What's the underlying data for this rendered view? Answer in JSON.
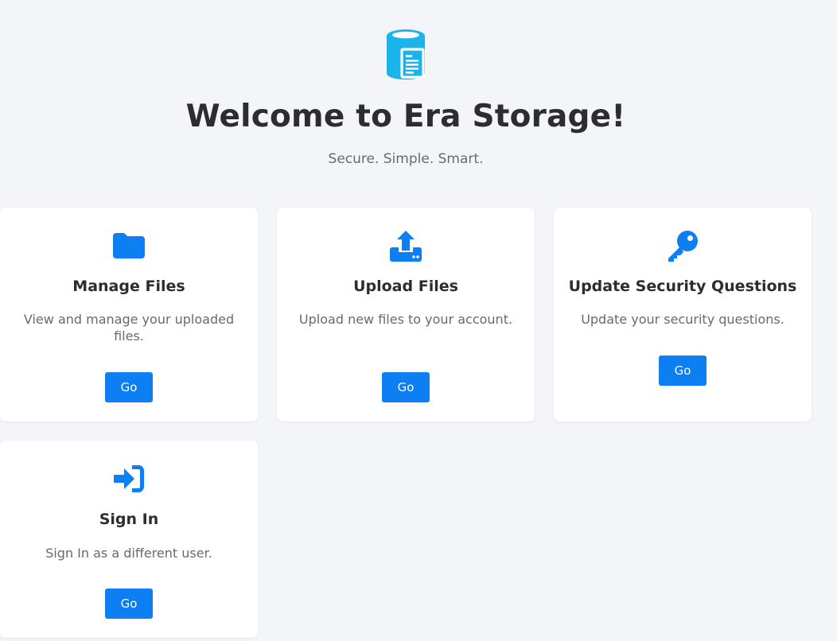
{
  "header": {
    "logo_icon": "database-document-icon",
    "title": "Welcome to Era Storage!",
    "tagline": "Secure. Simple. Smart."
  },
  "colors": {
    "background": "#f4f5f9",
    "accent": "#0d7ff2",
    "logo": "#1ab4ea",
    "heading": "#2d2d31",
    "muted": "#666a70"
  },
  "cards": [
    {
      "icon": "folder-icon",
      "title": "Manage Files",
      "description": "View and manage your uploaded files.",
      "button": "Go"
    },
    {
      "icon": "upload-icon",
      "title": "Upload Files",
      "description": "Upload new files to your account.",
      "button": "Go"
    },
    {
      "icon": "key-icon",
      "title": "Update Security Questions",
      "description": "Update your security questions.",
      "button": "Go"
    },
    {
      "icon": "sign-in-icon",
      "title": "Sign In",
      "description": "Sign In as a different user.",
      "button": "Go"
    }
  ]
}
